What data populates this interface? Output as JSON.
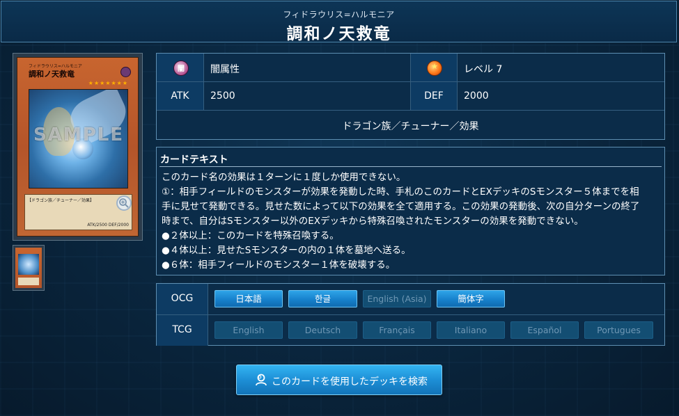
{
  "header": {
    "ruby": "フィドラウリス=ハルモニア",
    "title": "調和ノ天救竜"
  },
  "card_image": {
    "subname": "フィドラウリス=ハルモニア",
    "name": "調和ノ天救竜",
    "stars": "★★★★★★★",
    "watermark": "SAMPLE",
    "types_line": "【ドラゴン族／チューナー／効果】",
    "stats_line": "ATK/2500  DEF/2000"
  },
  "info": {
    "attribute_icon": "dark-attribute-icon",
    "attribute_icon_glyph": "闇",
    "attribute": "闇属性",
    "level_icon": "level-star-icon",
    "level_icon_glyph": "★",
    "level": "レベル 7",
    "atk_label": "ATK",
    "atk": "2500",
    "def_label": "DEF",
    "def": "2000",
    "types": "ドラゴン族／チューナー／効果"
  },
  "card_text": {
    "heading": "カードテキスト",
    "body": "このカード名の効果は１ターンに１度しか使用できない。\n①：相手フィールドのモンスターが効果を発動した時、手札のこのカードとEXデッキのSモンスター５体までを相\n手に見せて発動できる。見せた数によって以下の効果を全て適用する。この効果の発動後、次の自分ターンの終了\n時まで、自分はSモンスター以外のEXデッキから特殊召喚されたモンスターの効果を発動できない。\n●２体以上：このカードを特殊召喚する。\n●４体以上：見せたSモンスターの内の１体を墓地へ送る。\n●６体：相手フィールドのモンスター１体を破壊する。"
  },
  "languages": {
    "ocg_label": "OCG",
    "ocg": [
      {
        "label": "日本語",
        "enabled": true
      },
      {
        "label": "한글",
        "enabled": true
      },
      {
        "label": "English (Asia)",
        "enabled": false
      },
      {
        "label": "簡体字",
        "enabled": true
      }
    ],
    "tcg_label": "TCG",
    "tcg": [
      {
        "label": "English",
        "enabled": false
      },
      {
        "label": "Deutsch",
        "enabled": false
      },
      {
        "label": "Français",
        "enabled": false
      },
      {
        "label": "Italiano",
        "enabled": false
      },
      {
        "label": "Español",
        "enabled": false
      },
      {
        "label": "Portugues",
        "enabled": false
      }
    ]
  },
  "search_button": {
    "icon": "search-person-icon",
    "label": "このカードを使用したデッキを検索"
  },
  "colors": {
    "accent": "#1d8fd6",
    "panel": "#0b2c49",
    "label_cell": "#0d3b63",
    "disabled_button": "#134e73"
  }
}
